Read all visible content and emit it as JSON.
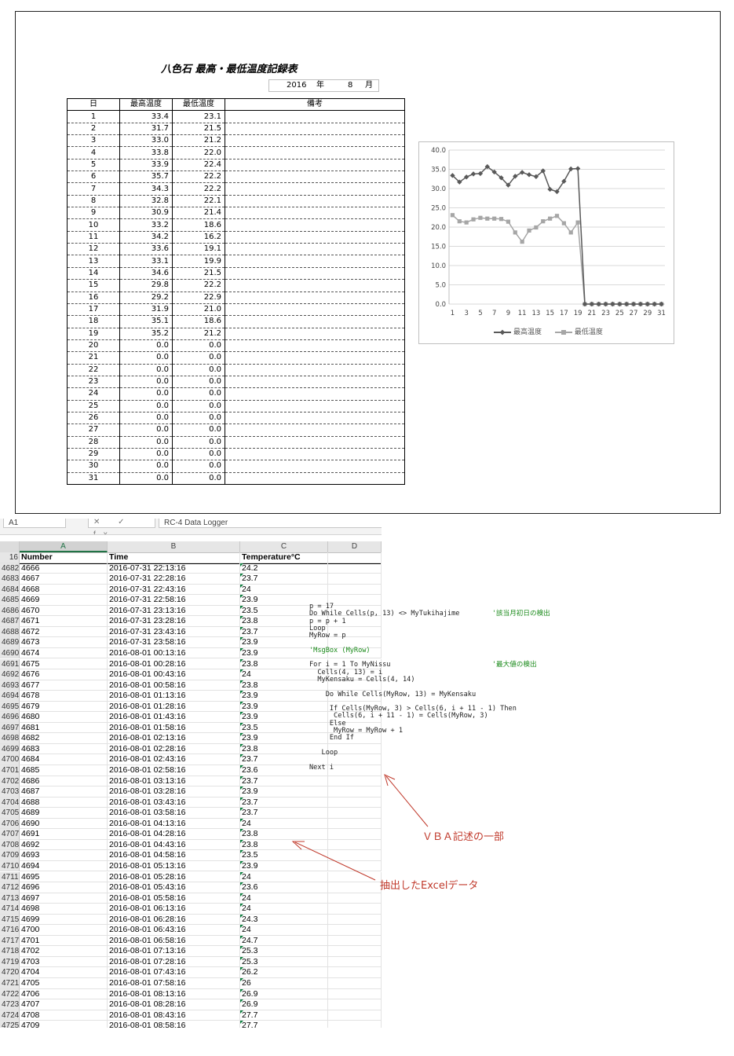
{
  "report": {
    "title": "八色石 最高・最低温度記録表",
    "year": "2016",
    "year_unit": "年",
    "month": "8",
    "month_unit": "月",
    "headers": [
      "日",
      "最高温度",
      "最低温度",
      "備考"
    ],
    "rows": [
      [
        "1",
        "33.4",
        "23.1"
      ],
      [
        "2",
        "31.7",
        "21.5"
      ],
      [
        "3",
        "33.0",
        "21.2"
      ],
      [
        "4",
        "33.8",
        "22.0"
      ],
      [
        "5",
        "33.9",
        "22.4"
      ],
      [
        "6",
        "35.7",
        "22.2"
      ],
      [
        "7",
        "34.3",
        "22.2"
      ],
      [
        "8",
        "32.8",
        "22.1"
      ],
      [
        "9",
        "30.9",
        "21.4"
      ],
      [
        "10",
        "33.2",
        "18.6"
      ],
      [
        "11",
        "34.2",
        "16.2"
      ],
      [
        "12",
        "33.6",
        "19.1"
      ],
      [
        "13",
        "33.1",
        "19.9"
      ],
      [
        "14",
        "34.6",
        "21.5"
      ],
      [
        "15",
        "29.8",
        "22.2"
      ],
      [
        "16",
        "29.2",
        "22.9"
      ],
      [
        "17",
        "31.9",
        "21.0"
      ],
      [
        "18",
        "35.1",
        "18.6"
      ],
      [
        "19",
        "35.2",
        "21.2"
      ],
      [
        "20",
        "0.0",
        "0.0"
      ],
      [
        "21",
        "0.0",
        "0.0"
      ],
      [
        "22",
        "0.0",
        "0.0"
      ],
      [
        "23",
        "0.0",
        "0.0"
      ],
      [
        "24",
        "0.0",
        "0.0"
      ],
      [
        "25",
        "0.0",
        "0.0"
      ],
      [
        "26",
        "0.0",
        "0.0"
      ],
      [
        "27",
        "0.0",
        "0.0"
      ],
      [
        "28",
        "0.0",
        "0.0"
      ],
      [
        "29",
        "0.0",
        "0.0"
      ],
      [
        "30",
        "0.0",
        "0.0"
      ],
      [
        "31",
        "0.0",
        "0.0"
      ]
    ]
  },
  "chart_data": {
    "type": "line",
    "x": [
      1,
      2,
      3,
      4,
      5,
      6,
      7,
      8,
      9,
      10,
      11,
      12,
      13,
      14,
      15,
      16,
      17,
      18,
      19,
      20,
      21,
      22,
      23,
      24,
      25,
      26,
      27,
      28,
      29,
      30,
      31
    ],
    "x_tick_labels": [
      "1",
      "3",
      "5",
      "7",
      "9",
      "11",
      "13",
      "15",
      "17",
      "19",
      "21",
      "23",
      "25",
      "27",
      "29",
      "31"
    ],
    "y_tick_labels": [
      "0.0",
      "5.0",
      "10.0",
      "15.0",
      "20.0",
      "25.0",
      "30.0",
      "35.0",
      "40.0"
    ],
    "ylim": [
      0,
      40
    ],
    "grid": true,
    "legend_position": "bottom",
    "series": [
      {
        "name": "最高温度",
        "color": "#595959",
        "marker": "diamond",
        "values": [
          33.4,
          31.7,
          33.0,
          33.8,
          33.9,
          35.7,
          34.3,
          32.8,
          30.9,
          33.2,
          34.2,
          33.6,
          33.1,
          34.6,
          29.8,
          29.2,
          31.9,
          35.1,
          35.2,
          0,
          0,
          0,
          0,
          0,
          0,
          0,
          0,
          0,
          0,
          0,
          0
        ]
      },
      {
        "name": "最低温度",
        "color": "#a6a6a6",
        "marker": "square",
        "values": [
          23.1,
          21.5,
          21.2,
          22.0,
          22.4,
          22.2,
          22.2,
          22.1,
          21.4,
          18.6,
          16.2,
          19.1,
          19.9,
          21.5,
          22.2,
          22.9,
          21.0,
          18.6,
          21.2,
          0,
          0,
          0,
          0,
          0,
          0,
          0,
          0,
          0,
          0,
          0,
          0
        ]
      }
    ]
  },
  "excel": {
    "name_box": "A1",
    "formula_icons": "✕ ✓ fx",
    "formula": "RC-4 Data Logger",
    "columns": [
      "A",
      "B",
      "C",
      "D"
    ],
    "header_row": {
      "row": "16",
      "a": "Number",
      "b": "Time",
      "c": "Temperature°C"
    },
    "rows": [
      [
        "4682",
        "4666",
        "2016-07-31 22:13:16",
        "24.2"
      ],
      [
        "4683",
        "4667",
        "2016-07-31 22:28:16",
        "23.7"
      ],
      [
        "4684",
        "4668",
        "2016-07-31 22:43:16",
        "24"
      ],
      [
        "4685",
        "4669",
        "2016-07-31 22:58:16",
        "23.9"
      ],
      [
        "4686",
        "4670",
        "2016-07-31 23:13:16",
        "23.5"
      ],
      [
        "4687",
        "4671",
        "2016-07-31 23:28:16",
        "23.8"
      ],
      [
        "4688",
        "4672",
        "2016-07-31 23:43:16",
        "23.7"
      ],
      [
        "4689",
        "4673",
        "2016-07-31 23:58:16",
        "23.9"
      ],
      [
        "4690",
        "4674",
        "2016-08-01 00:13:16",
        "23.9"
      ],
      [
        "4691",
        "4675",
        "2016-08-01 00:28:16",
        "23.8"
      ],
      [
        "4692",
        "4676",
        "2016-08-01 00:43:16",
        "24"
      ],
      [
        "4693",
        "4677",
        "2016-08-01 00:58:16",
        "23.8"
      ],
      [
        "4694",
        "4678",
        "2016-08-01 01:13:16",
        "23.9"
      ],
      [
        "4695",
        "4679",
        "2016-08-01 01:28:16",
        "23.9"
      ],
      [
        "4696",
        "4680",
        "2016-08-01 01:43:16",
        "23.9"
      ],
      [
        "4697",
        "4681",
        "2016-08-01 01:58:16",
        "23.5"
      ],
      [
        "4698",
        "4682",
        "2016-08-01 02:13:16",
        "23.9"
      ],
      [
        "4699",
        "4683",
        "2016-08-01 02:28:16",
        "23.8"
      ],
      [
        "4700",
        "4684",
        "2016-08-01 02:43:16",
        "23.7"
      ],
      [
        "4701",
        "4685",
        "2016-08-01 02:58:16",
        "23.6"
      ],
      [
        "4702",
        "4686",
        "2016-08-01 03:13:16",
        "23.7"
      ],
      [
        "4703",
        "4687",
        "2016-08-01 03:28:16",
        "23.9"
      ],
      [
        "4704",
        "4688",
        "2016-08-01 03:43:16",
        "23.7"
      ],
      [
        "4705",
        "4689",
        "2016-08-01 03:58:16",
        "23.7"
      ],
      [
        "4706",
        "4690",
        "2016-08-01 04:13:16",
        "24"
      ],
      [
        "4707",
        "4691",
        "2016-08-01 04:28:16",
        "23.8"
      ],
      [
        "4708",
        "4692",
        "2016-08-01 04:43:16",
        "23.8"
      ],
      [
        "4709",
        "4693",
        "2016-08-01 04:58:16",
        "23.5"
      ],
      [
        "4710",
        "4694",
        "2016-08-01 05:13:16",
        "23.9"
      ],
      [
        "4711",
        "4695",
        "2016-08-01 05:28:16",
        "24"
      ],
      [
        "4712",
        "4696",
        "2016-08-01 05:43:16",
        "23.6"
      ],
      [
        "4713",
        "4697",
        "2016-08-01 05:58:16",
        "24"
      ],
      [
        "4714",
        "4698",
        "2016-08-01 06:13:16",
        "24"
      ],
      [
        "4715",
        "4699",
        "2016-08-01 06:28:16",
        "24.3"
      ],
      [
        "4716",
        "4700",
        "2016-08-01 06:43:16",
        "24"
      ],
      [
        "4717",
        "4701",
        "2016-08-01 06:58:16",
        "24.7"
      ],
      [
        "4718",
        "4702",
        "2016-08-01 07:13:16",
        "25.3"
      ],
      [
        "4719",
        "4703",
        "2016-08-01 07:28:16",
        "25.3"
      ],
      [
        "4720",
        "4704",
        "2016-08-01 07:43:16",
        "26.2"
      ],
      [
        "4721",
        "4705",
        "2016-08-01 07:58:16",
        "26"
      ],
      [
        "4722",
        "4706",
        "2016-08-01 08:13:16",
        "26.9"
      ],
      [
        "4723",
        "4707",
        "2016-08-01 08:28:16",
        "26.9"
      ],
      [
        "4724",
        "4708",
        "2016-08-01 08:43:16",
        "27.7"
      ],
      [
        "4725",
        "4709",
        "2016-08-01 08:58:16",
        "27.7"
      ]
    ]
  },
  "vba": {
    "lines": [
      {
        "code": "p = 17",
        "comment": ""
      },
      {
        "code": "Do While Cells(p, 13) <> MyTukihajime        ",
        "comment": "'該当月初日の検出"
      },
      {
        "code": "p = p + 1",
        "comment": ""
      },
      {
        "code": "Loop",
        "comment": ""
      },
      {
        "code": "MyRow = p",
        "comment": ""
      },
      {
        "code": "",
        "comment": ""
      },
      {
        "code": "",
        "comment": "'MsgBox (MyRow)"
      },
      {
        "code": "",
        "comment": ""
      },
      {
        "code": "For i = 1 To MyNissu                         ",
        "comment": "'最大値の検出"
      },
      {
        "code": "  Cells(4, 13) = i",
        "comment": ""
      },
      {
        "code": "  MyKensaku = Cells(4, 14)",
        "comment": ""
      },
      {
        "code": "",
        "comment": ""
      },
      {
        "code": "    Do While Cells(MyRow, 13) = MyKensaku",
        "comment": ""
      },
      {
        "code": "",
        "comment": ""
      },
      {
        "code": "     If Cells(MyRow, 3) > Cells(6, i + 11 - 1) Then",
        "comment": ""
      },
      {
        "code": "      Cells(6, i + 11 - 1) = Cells(MyRow, 3)",
        "comment": ""
      },
      {
        "code": "     Else",
        "comment": ""
      },
      {
        "code": "      MyRow = MyRow + 1",
        "comment": ""
      },
      {
        "code": "     End If",
        "comment": ""
      },
      {
        "code": "",
        "comment": ""
      },
      {
        "code": "   Loop",
        "comment": ""
      },
      {
        "code": "",
        "comment": ""
      },
      {
        "code": "Next i",
        "comment": ""
      }
    ]
  },
  "annotations": {
    "vba_label": "ＶＢＡ記述の一部",
    "excel_label": "抽出したExcelデータ",
    "color": "#c0392b"
  }
}
